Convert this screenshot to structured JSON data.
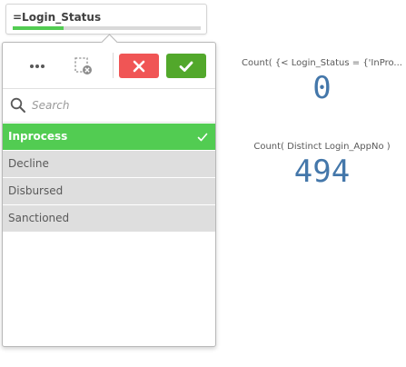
{
  "field": {
    "title": "=Login_Status",
    "selected_fraction": 0.27
  },
  "toolbar": {
    "more_icon": "ellipsis-icon",
    "clear_icon": "clear-selection-icon",
    "cancel_icon": "close-icon",
    "confirm_icon": "check-icon"
  },
  "search": {
    "placeholder": "Search",
    "value": ""
  },
  "list": {
    "items": [
      {
        "label": "Inprocess",
        "state": "selected"
      },
      {
        "label": "Decline",
        "state": "alternative"
      },
      {
        "label": "Disbursed",
        "state": "alternative"
      },
      {
        "label": "Sanctioned",
        "state": "alternative"
      }
    ]
  },
  "kpis": [
    {
      "label": "Count( {< Login_Status = {'InPro...",
      "value": "0"
    },
    {
      "label": "Count( Distinct Login_AppNo )",
      "value": "494"
    }
  ],
  "colors": {
    "selected": "#52cc52",
    "cancel": "#f05555",
    "confirm": "#52a82b",
    "kpi_value": "#4477aa",
    "alternative": "#dedede"
  }
}
